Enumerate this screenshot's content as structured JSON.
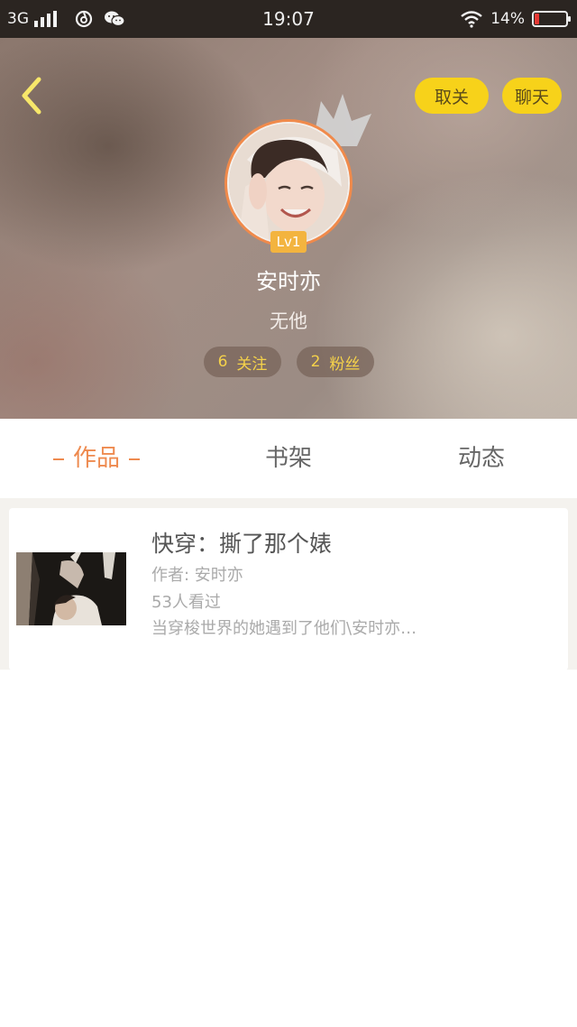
{
  "status_bar": {
    "network": "3G",
    "time": "19:07",
    "battery_text": "14%",
    "battery_level": 0.14,
    "icons": [
      "signal-icon",
      "netease-music-icon",
      "wechat-icon",
      "wifi-icon",
      "battery-icon"
    ]
  },
  "header": {
    "back_icon": "chevron-left-icon",
    "unfollow_label": "取关",
    "chat_label": "聊天",
    "level": "Lv1",
    "username": "安时亦",
    "signature": "无他",
    "following_count": "6",
    "following_label": "关注",
    "fans_count": "2",
    "fans_label": "粉丝"
  },
  "tabs": [
    {
      "label": "作品",
      "active": true
    },
    {
      "label": "书架",
      "active": false
    },
    {
      "label": "动态",
      "active": false
    }
  ],
  "works": [
    {
      "title": "快穿：撕了那个婊",
      "author": "作者: 安时亦",
      "reads": "53人看过",
      "description": "当穿梭世界的她遇到了他们\\安时亦…"
    }
  ],
  "colors": {
    "accent_orange": "#ee8a4f",
    "button_yellow": "#f7d21a",
    "stat_text": "#f5d24a",
    "level_badge": "#f3b43f",
    "status_bar_bg": "#2b2521"
  }
}
